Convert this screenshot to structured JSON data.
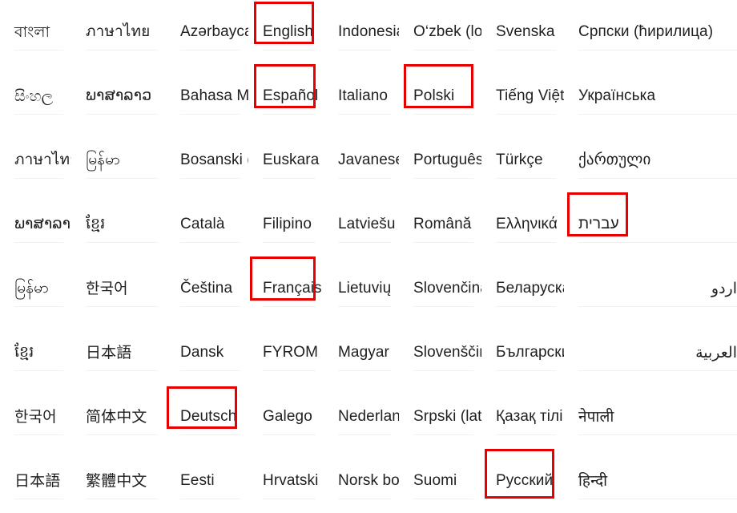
{
  "screen": {
    "kind": "language-picker-grid",
    "columns": 8,
    "rows": 8,
    "background_color": "#ffffff",
    "text_color": "#1f1f1f",
    "divider_color": "#f1f1f1",
    "highlight_color": "#e60000"
  },
  "grid": {
    "rows": [
      [
        {
          "label": "বাংলা",
          "script": "indic",
          "highlighted": false
        },
        {
          "label": "ภาษาไทย",
          "script": "thai",
          "highlighted": false
        },
        {
          "label": "Azərbaycan",
          "script": "latin",
          "highlighted": false
        },
        {
          "label": "English",
          "script": "latin",
          "highlighted": true,
          "box": "box-english"
        },
        {
          "label": "Indonesia",
          "script": "latin",
          "highlighted": false
        },
        {
          "label": "O‘zbek (lotin)",
          "script": "latin",
          "highlighted": false
        },
        {
          "label": "Svenska",
          "script": "latin",
          "highlighted": false
        },
        {
          "label": "Српски (ћирилица)",
          "script": "cyrillic",
          "highlighted": false
        }
      ],
      [
        {
          "label": "සිංහල",
          "script": "indic",
          "highlighted": false
        },
        {
          "label": "ພາສາລາວ",
          "script": "lao",
          "highlighted": false
        },
        {
          "label": "Bahasa Melayu",
          "script": "latin",
          "highlighted": false
        },
        {
          "label": "Español",
          "script": "latin",
          "highlighted": true,
          "box": "box-espanol"
        },
        {
          "label": "Italiano",
          "script": "latin",
          "highlighted": false
        },
        {
          "label": "Polski",
          "script": "latin",
          "highlighted": true,
          "box": "box-polski"
        },
        {
          "label": "Tiếng Việt",
          "script": "latin",
          "highlighted": false
        },
        {
          "label": "Українська",
          "script": "cyrillic",
          "highlighted": false
        }
      ],
      [
        {
          "label": "ภาษาไทย",
          "script": "thai",
          "highlighted": false
        },
        {
          "label": "မြန်မာ",
          "script": "burmese",
          "highlighted": false
        },
        {
          "label": "Bosanski (latinica)",
          "script": "latin",
          "highlighted": false
        },
        {
          "label": "Euskara",
          "script": "latin",
          "highlighted": false
        },
        {
          "label": "Javanese (Jawa)",
          "script": "latin",
          "highlighted": false
        },
        {
          "label": "Português",
          "script": "latin",
          "highlighted": false
        },
        {
          "label": "Türkçe",
          "script": "latin",
          "highlighted": false
        },
        {
          "label": "ქართული",
          "script": "georgian",
          "highlighted": false
        }
      ],
      [
        {
          "label": "ພາສາລາວ",
          "script": "lao",
          "highlighted": false
        },
        {
          "label": "ខ្មែរ",
          "script": "khmer",
          "highlighted": false
        },
        {
          "label": "Català",
          "script": "latin",
          "highlighted": false
        },
        {
          "label": "Filipino",
          "script": "latin",
          "highlighted": false
        },
        {
          "label": "Latviešu",
          "script": "latin",
          "highlighted": false
        },
        {
          "label": "Română",
          "script": "latin",
          "highlighted": false
        },
        {
          "label": "Ελληνικά",
          "script": "greek",
          "highlighted": false
        },
        {
          "label": "עברית",
          "script": "hebrew",
          "highlighted": true,
          "box": "box-hebrew"
        }
      ],
      [
        {
          "label": "မြန်မာ",
          "script": "burmese",
          "highlighted": false
        },
        {
          "label": "한국어",
          "script": "cjk",
          "highlighted": false
        },
        {
          "label": "Čeština",
          "script": "latin",
          "highlighted": false
        },
        {
          "label": "Français",
          "script": "latin",
          "highlighted": true,
          "box": "box-francais"
        },
        {
          "label": "Lietuvių",
          "script": "latin",
          "highlighted": false
        },
        {
          "label": "Slovenčina",
          "script": "latin",
          "highlighted": false
        },
        {
          "label": "Беларуская",
          "script": "cyrillic",
          "highlighted": false
        },
        {
          "label": "اردو",
          "script": "arabic",
          "highlighted": false
        }
      ],
      [
        {
          "label": "ខ្មែរ",
          "script": "khmer",
          "highlighted": false
        },
        {
          "label": "日本語",
          "script": "cjk",
          "highlighted": false
        },
        {
          "label": "Dansk",
          "script": "latin",
          "highlighted": false
        },
        {
          "label": "FYROM",
          "script": "latin",
          "highlighted": false
        },
        {
          "label": "Magyar",
          "script": "latin",
          "highlighted": false
        },
        {
          "label": "Slovenščina",
          "script": "latin",
          "highlighted": false
        },
        {
          "label": "Български",
          "script": "cyrillic",
          "highlighted": false
        },
        {
          "label": "العربية",
          "script": "arabic",
          "highlighted": false
        }
      ],
      [
        {
          "label": "한국어",
          "script": "cjk",
          "highlighted": false
        },
        {
          "label": "简体中文",
          "script": "cjk",
          "highlighted": false
        },
        {
          "label": "Deutsch",
          "script": "latin",
          "highlighted": true,
          "box": "box-deutsch"
        },
        {
          "label": "Galego",
          "script": "latin",
          "highlighted": false
        },
        {
          "label": "Nederlands",
          "script": "latin",
          "highlighted": false
        },
        {
          "label": "Srpski (latinica)",
          "script": "latin",
          "highlighted": false
        },
        {
          "label": "Қазақ тілі",
          "script": "cyrillic",
          "highlighted": false
        },
        {
          "label": "नेपाली",
          "script": "indic",
          "highlighted": false
        }
      ],
      [
        {
          "label": "日本語",
          "script": "cjk",
          "highlighted": false
        },
        {
          "label": "繁體中文",
          "script": "cjk",
          "highlighted": false
        },
        {
          "label": "Eesti",
          "script": "latin",
          "highlighted": false
        },
        {
          "label": "Hrvatski",
          "script": "latin",
          "highlighted": false
        },
        {
          "label": "Norsk bokmål",
          "script": "latin",
          "highlighted": false
        },
        {
          "label": "Suomi",
          "script": "latin",
          "highlighted": false
        },
        {
          "label": "Русский",
          "script": "cyrillic",
          "highlighted": true,
          "box": "box-russian"
        },
        {
          "label": "हिन्दी",
          "script": "indic",
          "highlighted": false
        }
      ]
    ]
  }
}
